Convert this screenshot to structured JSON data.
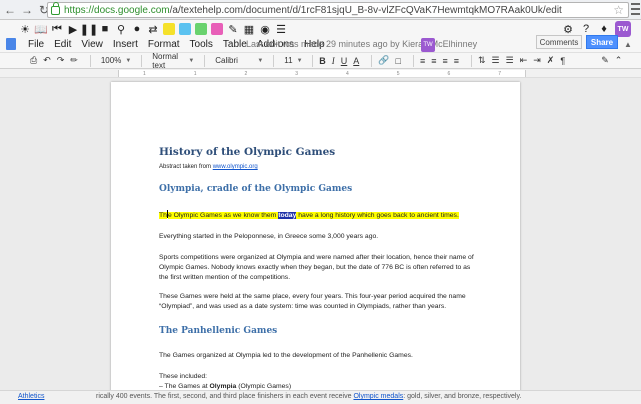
{
  "browser": {
    "url_host": "https://docs.google.com",
    "url_path": "/a/textehelp.com/document/d/1rcF81sjqU_B-8v-vlZFcQVaK7HewmtqkMO7RAak0Uk/edit"
  },
  "extension_toolbar": {
    "highlight_colors": [
      "#f5e12a",
      "#5bc2f0",
      "#69d26e",
      "#e85fb8"
    ],
    "badge_label": "TW"
  },
  "docs_menu": {
    "items": [
      "File",
      "Edit",
      "View",
      "Insert",
      "Format",
      "Tools",
      "Table",
      "Add-ons",
      "Help"
    ],
    "last_edit": "Last edit was made 29 minutes ago by Kieran McElhinney",
    "comments_label": "Comments",
    "share_label": "Share",
    "float_badge": "TW"
  },
  "format_toolbar": {
    "zoom": "100%",
    "style": "Normal text",
    "font": "Calibri",
    "size": "11",
    "bold": "B",
    "italic": "I",
    "underline": "U"
  },
  "ruler": {
    "marks": [
      "1",
      "1",
      "2",
      "3",
      "4",
      "5",
      "6",
      "7"
    ]
  },
  "document": {
    "title": "History of the Olympic Games",
    "abstract_prefix": "Abstract taken from ",
    "abstract_link": "www.olympic.org",
    "h2_1": "Olympia, cradle of the Olympic Games",
    "highlight_before_cursor": "Th",
    "highlight_after_cursor": "e Olympic Games as we know them ",
    "highlight_selected": "today",
    "highlight_end": " have a long history which goes back to ancient times.",
    "para_1": "Everything started in the Peloponnese, in Greece some 3,000 years ago.",
    "para_2": "Sports competitions were organized at Olympia and were named after their location, hence their name of Olympic Games. Nobody knows exactly when they began, but the date of 776 BC is often referred to as the first written mention of the competitions.",
    "para_3": "These Games were held at the same place, every four years. This four-year period acquired the name “Olympiad”, and was used as a date system: time was counted in Olympiads, rather than years.",
    "h2_2": "The Panhellenic Games",
    "para_4": "The Games organized at Olympia led to the development of the Panhellenic Games.",
    "para_5": "These included:",
    "list_1_prefix": "– The Games at ",
    "list_1_bold": "Olympia",
    "list_1_suffix": " (Olympic Games)"
  },
  "bottom_strip": {
    "left_link": "Athletics",
    "text_start": "rically 400 events. The first, second, and third place finishers in each event receive ",
    "text_link": "Olympic medals",
    "text_end": ": gold, silver, and bronze, respectively."
  }
}
